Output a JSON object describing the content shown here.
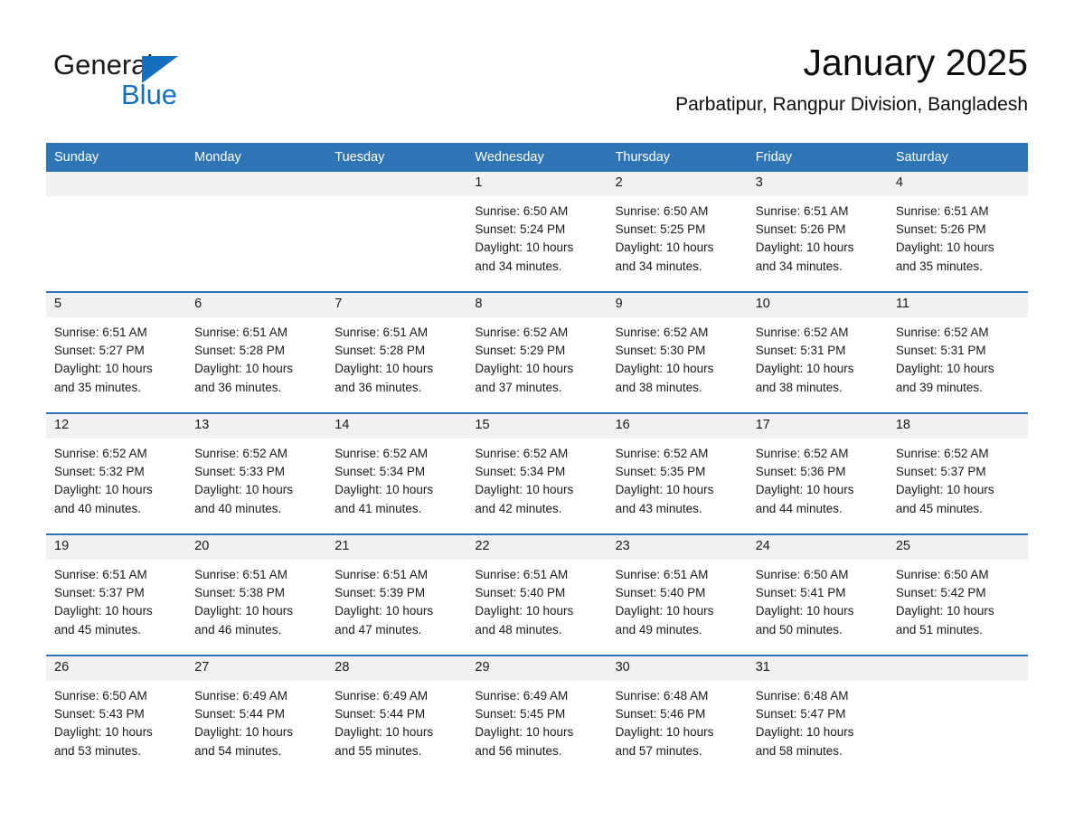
{
  "brand": {
    "name_part1": "General",
    "name_part2": "Blue",
    "triangle_color": "#1470bd",
    "text_color": "#1a1a1a"
  },
  "header": {
    "month_title": "January 2025",
    "location": "Parbatipur, Rangpur Division, Bangladesh"
  },
  "theme": {
    "header_blue": "#2f74b5",
    "row_separator_blue": "#2f74b5",
    "daynum_band_gray": "#f1f1f1",
    "page_background": "#ffffff",
    "text_black": "#1a1a1a"
  },
  "weekday_headers": [
    "Sunday",
    "Monday",
    "Tuesday",
    "Wednesday",
    "Thursday",
    "Friday",
    "Saturday"
  ],
  "weeks": [
    [
      {
        "day": "",
        "empty": true
      },
      {
        "day": "",
        "empty": true
      },
      {
        "day": "",
        "empty": true
      },
      {
        "day": "1",
        "sunrise": "Sunrise: 6:50 AM",
        "sunset": "Sunset: 5:24 PM",
        "daylight_line1": "Daylight: 10 hours",
        "daylight_line2": "and 34 minutes."
      },
      {
        "day": "2",
        "sunrise": "Sunrise: 6:50 AM",
        "sunset": "Sunset: 5:25 PM",
        "daylight_line1": "Daylight: 10 hours",
        "daylight_line2": "and 34 minutes."
      },
      {
        "day": "3",
        "sunrise": "Sunrise: 6:51 AM",
        "sunset": "Sunset: 5:26 PM",
        "daylight_line1": "Daylight: 10 hours",
        "daylight_line2": "and 34 minutes."
      },
      {
        "day": "4",
        "sunrise": "Sunrise: 6:51 AM",
        "sunset": "Sunset: 5:26 PM",
        "daylight_line1": "Daylight: 10 hours",
        "daylight_line2": "and 35 minutes."
      }
    ],
    [
      {
        "day": "5",
        "sunrise": "Sunrise: 6:51 AM",
        "sunset": "Sunset: 5:27 PM",
        "daylight_line1": "Daylight: 10 hours",
        "daylight_line2": "and 35 minutes."
      },
      {
        "day": "6",
        "sunrise": "Sunrise: 6:51 AM",
        "sunset": "Sunset: 5:28 PM",
        "daylight_line1": "Daylight: 10 hours",
        "daylight_line2": "and 36 minutes."
      },
      {
        "day": "7",
        "sunrise": "Sunrise: 6:51 AM",
        "sunset": "Sunset: 5:28 PM",
        "daylight_line1": "Daylight: 10 hours",
        "daylight_line2": "and 36 minutes."
      },
      {
        "day": "8",
        "sunrise": "Sunrise: 6:52 AM",
        "sunset": "Sunset: 5:29 PM",
        "daylight_line1": "Daylight: 10 hours",
        "daylight_line2": "and 37 minutes."
      },
      {
        "day": "9",
        "sunrise": "Sunrise: 6:52 AM",
        "sunset": "Sunset: 5:30 PM",
        "daylight_line1": "Daylight: 10 hours",
        "daylight_line2": "and 38 minutes."
      },
      {
        "day": "10",
        "sunrise": "Sunrise: 6:52 AM",
        "sunset": "Sunset: 5:31 PM",
        "daylight_line1": "Daylight: 10 hours",
        "daylight_line2": "and 38 minutes."
      },
      {
        "day": "11",
        "sunrise": "Sunrise: 6:52 AM",
        "sunset": "Sunset: 5:31 PM",
        "daylight_line1": "Daylight: 10 hours",
        "daylight_line2": "and 39 minutes."
      }
    ],
    [
      {
        "day": "12",
        "sunrise": "Sunrise: 6:52 AM",
        "sunset": "Sunset: 5:32 PM",
        "daylight_line1": "Daylight: 10 hours",
        "daylight_line2": "and 40 minutes."
      },
      {
        "day": "13",
        "sunrise": "Sunrise: 6:52 AM",
        "sunset": "Sunset: 5:33 PM",
        "daylight_line1": "Daylight: 10 hours",
        "daylight_line2": "and 40 minutes."
      },
      {
        "day": "14",
        "sunrise": "Sunrise: 6:52 AM",
        "sunset": "Sunset: 5:34 PM",
        "daylight_line1": "Daylight: 10 hours",
        "daylight_line2": "and 41 minutes."
      },
      {
        "day": "15",
        "sunrise": "Sunrise: 6:52 AM",
        "sunset": "Sunset: 5:34 PM",
        "daylight_line1": "Daylight: 10 hours",
        "daylight_line2": "and 42 minutes."
      },
      {
        "day": "16",
        "sunrise": "Sunrise: 6:52 AM",
        "sunset": "Sunset: 5:35 PM",
        "daylight_line1": "Daylight: 10 hours",
        "daylight_line2": "and 43 minutes."
      },
      {
        "day": "17",
        "sunrise": "Sunrise: 6:52 AM",
        "sunset": "Sunset: 5:36 PM",
        "daylight_line1": "Daylight: 10 hours",
        "daylight_line2": "and 44 minutes."
      },
      {
        "day": "18",
        "sunrise": "Sunrise: 6:52 AM",
        "sunset": "Sunset: 5:37 PM",
        "daylight_line1": "Daylight: 10 hours",
        "daylight_line2": "and 45 minutes."
      }
    ],
    [
      {
        "day": "19",
        "sunrise": "Sunrise: 6:51 AM",
        "sunset": "Sunset: 5:37 PM",
        "daylight_line1": "Daylight: 10 hours",
        "daylight_line2": "and 45 minutes."
      },
      {
        "day": "20",
        "sunrise": "Sunrise: 6:51 AM",
        "sunset": "Sunset: 5:38 PM",
        "daylight_line1": "Daylight: 10 hours",
        "daylight_line2": "and 46 minutes."
      },
      {
        "day": "21",
        "sunrise": "Sunrise: 6:51 AM",
        "sunset": "Sunset: 5:39 PM",
        "daylight_line1": "Daylight: 10 hours",
        "daylight_line2": "and 47 minutes."
      },
      {
        "day": "22",
        "sunrise": "Sunrise: 6:51 AM",
        "sunset": "Sunset: 5:40 PM",
        "daylight_line1": "Daylight: 10 hours",
        "daylight_line2": "and 48 minutes."
      },
      {
        "day": "23",
        "sunrise": "Sunrise: 6:51 AM",
        "sunset": "Sunset: 5:40 PM",
        "daylight_line1": "Daylight: 10 hours",
        "daylight_line2": "and 49 minutes."
      },
      {
        "day": "24",
        "sunrise": "Sunrise: 6:50 AM",
        "sunset": "Sunset: 5:41 PM",
        "daylight_line1": "Daylight: 10 hours",
        "daylight_line2": "and 50 minutes."
      },
      {
        "day": "25",
        "sunrise": "Sunrise: 6:50 AM",
        "sunset": "Sunset: 5:42 PM",
        "daylight_line1": "Daylight: 10 hours",
        "daylight_line2": "and 51 minutes."
      }
    ],
    [
      {
        "day": "26",
        "sunrise": "Sunrise: 6:50 AM",
        "sunset": "Sunset: 5:43 PM",
        "daylight_line1": "Daylight: 10 hours",
        "daylight_line2": "and 53 minutes."
      },
      {
        "day": "27",
        "sunrise": "Sunrise: 6:49 AM",
        "sunset": "Sunset: 5:44 PM",
        "daylight_line1": "Daylight: 10 hours",
        "daylight_line2": "and 54 minutes."
      },
      {
        "day": "28",
        "sunrise": "Sunrise: 6:49 AM",
        "sunset": "Sunset: 5:44 PM",
        "daylight_line1": "Daylight: 10 hours",
        "daylight_line2": "and 55 minutes."
      },
      {
        "day": "29",
        "sunrise": "Sunrise: 6:49 AM",
        "sunset": "Sunset: 5:45 PM",
        "daylight_line1": "Daylight: 10 hours",
        "daylight_line2": "and 56 minutes."
      },
      {
        "day": "30",
        "sunrise": "Sunrise: 6:48 AM",
        "sunset": "Sunset: 5:46 PM",
        "daylight_line1": "Daylight: 10 hours",
        "daylight_line2": "and 57 minutes."
      },
      {
        "day": "31",
        "sunrise": "Sunrise: 6:48 AM",
        "sunset": "Sunset: 5:47 PM",
        "daylight_line1": "Daylight: 10 hours",
        "daylight_line2": "and 58 minutes."
      },
      {
        "day": "",
        "empty": true
      }
    ]
  ]
}
